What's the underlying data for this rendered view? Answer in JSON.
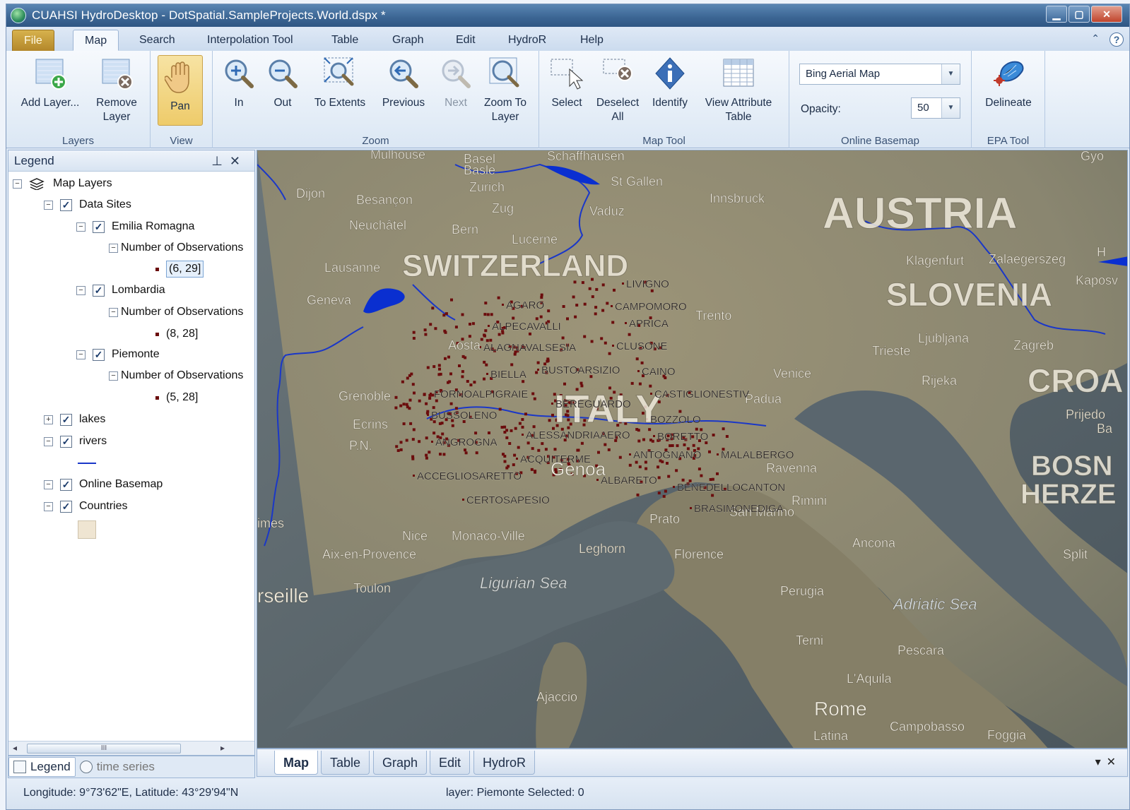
{
  "title": "CUAHSI HydroDesktop - DotSpatial.SampleProjects.World.dspx *",
  "ribbon_tabs": [
    "File",
    "Map",
    "Search",
    "Interpolation Tool",
    "Table",
    "Graph",
    "Edit",
    "HydroR",
    "Help"
  ],
  "active_tab": "Map",
  "groups": {
    "layers": {
      "caption": "Layers",
      "add": "Add Layer...",
      "remove": "Remove Layer"
    },
    "view": {
      "caption": "View",
      "pan": "Pan"
    },
    "zoom": {
      "caption": "Zoom",
      "in": "In",
      "out": "Out",
      "extents": "To Extents",
      "previous": "Previous",
      "next": "Next",
      "zoom_layer": "Zoom To Layer"
    },
    "maptool": {
      "caption": "Map Tool",
      "select": "Select",
      "deselect": "Deselect All",
      "identify": "Identify",
      "attr": "View Attribute Table"
    },
    "basemap": {
      "caption": "Online Basemap",
      "selected": "Bing Aerial Map",
      "opacity_label": "Opacity:",
      "opacity_value": "50"
    },
    "epa": {
      "caption": "EPA Tool",
      "delineate": "Delineate"
    }
  },
  "legend": {
    "title": "Legend",
    "root": "Map Layers",
    "data_sites": "Data Sites",
    "groups": [
      {
        "name": "Emilia Romagna",
        "field": "Number of Observations",
        "range": "(6, 29]"
      },
      {
        "name": "Lombardia",
        "field": "Number of Observations",
        "range": "(8, 28]"
      },
      {
        "name": "Piemonte",
        "field": "Number of Observations",
        "range": "(5, 28]"
      }
    ],
    "lakes": "lakes",
    "rivers": "rivers",
    "basemap": "Online Basemap",
    "countries": "Countries",
    "scroll_label": "III"
  },
  "panel_tabs": [
    "Legend",
    "time series"
  ],
  "map_tabs": [
    "Map",
    "Table",
    "Graph",
    "Edit",
    "HydroR"
  ],
  "map_labels": {
    "countries": [
      "AUSTRIA",
      "SWITZERLAND",
      "SLOVENIA",
      "CROA",
      "BOSN",
      "HERZE",
      "ITALY"
    ],
    "cities": [
      "Mulhouse",
      "Basel",
      "Basle",
      "Schaffhausen",
      "St Gallen",
      "Zurich",
      "Zug",
      "Dijon",
      "Besançon",
      "Neuchâtel",
      "Bern",
      "Lucerne",
      "Vaduz",
      "Innsbruck",
      "Lausanne",
      "Geneva",
      "Aosta",
      "Grenoble",
      "Trento",
      "Klagenfurt",
      "Zalaegerszeg",
      "Kaposv",
      "Ljubljana",
      "Zagreb",
      "Trieste",
      "Rijeka",
      "Venice",
      "Padua",
      "Prijedo",
      "Ba",
      "Ravenna",
      "Rimini",
      "San Marino",
      "Prato",
      "Florence",
      "Nice",
      "Monaco-Ville",
      "Aix-en-Provence",
      "Toulon",
      "rseille",
      "Leghorn",
      "Ancona",
      "Split",
      "Perugia",
      "Terni",
      "Pescara",
      "L'Aquila",
      "Rome",
      "Latina",
      "Campobasso",
      "Foggia",
      "Ajaccio",
      "Genoa",
      "Ecrins",
      "P.N.",
      "imes",
      "Gyo",
      "H"
    ],
    "seas": [
      "Ligurian Sea",
      "Adriatic Sea"
    ],
    "sites": [
      "LIVIGNO",
      "AGARO",
      "CAMPOMORO",
      "APRICA",
      "ALPECAVALLI",
      "ALAGNAVALSESIA",
      "CLUSONE",
      "BIELLA",
      "BUSTOARSIZIO",
      "CAINO",
      "CASTIGLIONESTIV",
      "FORNOALPIGRAIE",
      "BEREGUARDO",
      "BUSSOLENO",
      "BOZZOLO",
      "ALESSANDRIAAERO",
      "BORETTO",
      "ANGROGNA",
      "ACQUITERME",
      "ANTOGNANO",
      "MALALBERGO",
      "ACCEGLIOSARETTO",
      "ALBARETO",
      "BENEDELLOCANTON",
      "CERTOSAPESIO",
      "BRASIMONEDIGA"
    ]
  },
  "status": {
    "coords": "Longitude: 9°73'62\"E, Latitude: 43°29'94\"N",
    "layer": "layer: Piemonte Selected: 0"
  },
  "colors": {
    "title_bar": "#3b6593",
    "site_marker": "#6b0d0d",
    "river": "#1a37c8",
    "lake": "#0a2fd0",
    "map_land": "#8d8a72",
    "map_sea": "#57636b"
  }
}
